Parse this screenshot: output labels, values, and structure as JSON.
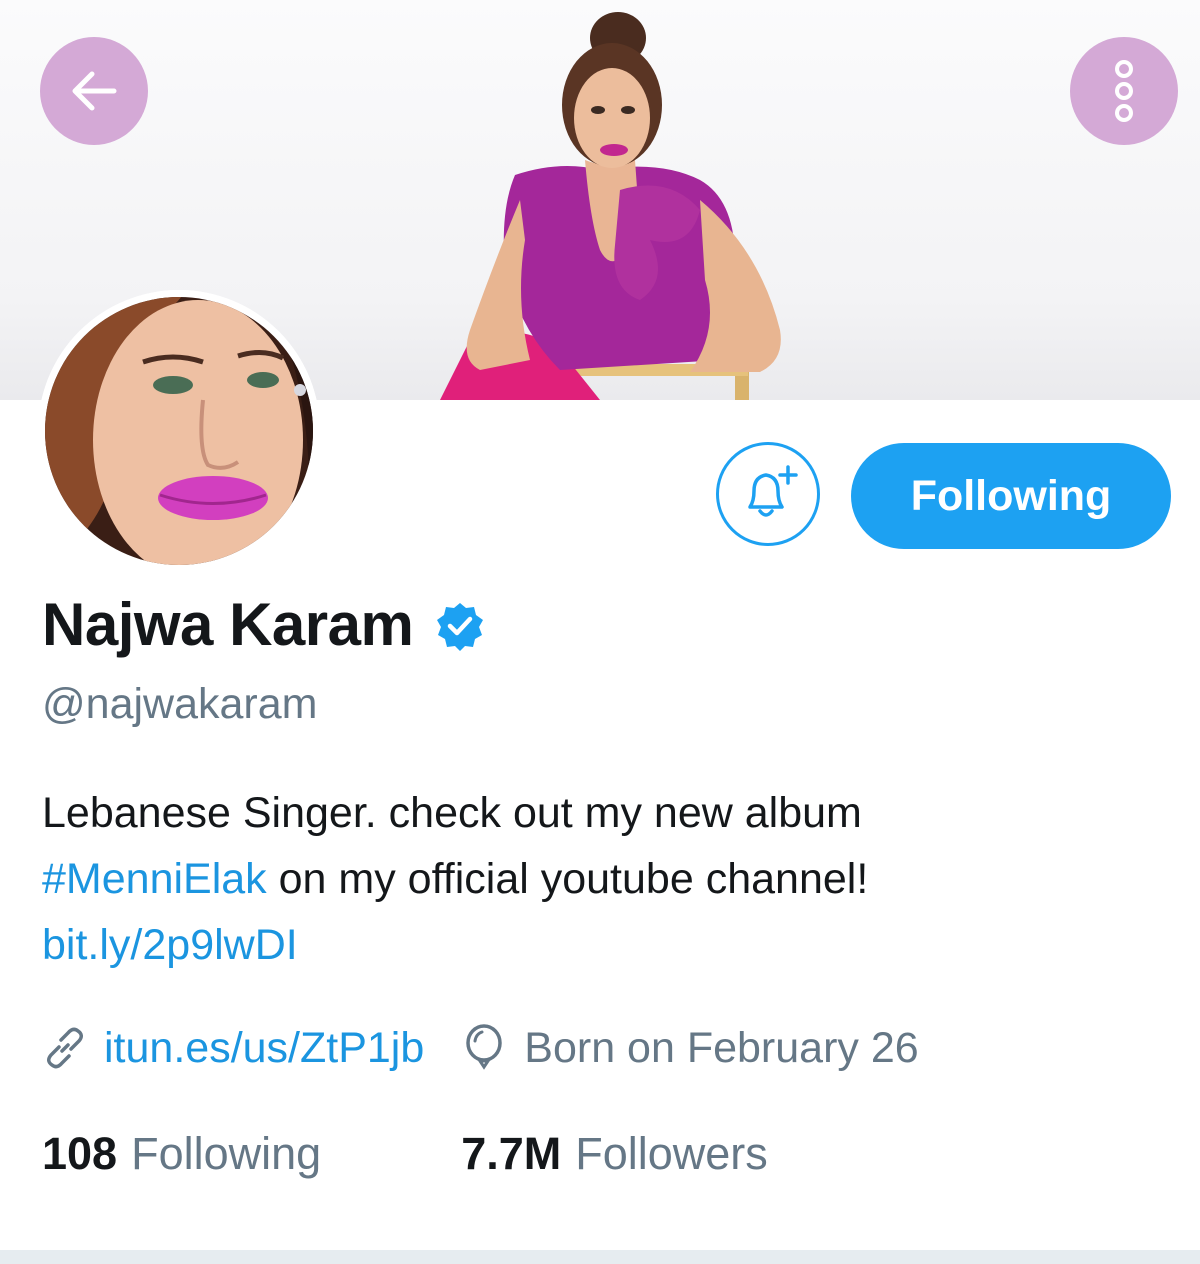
{
  "profile": {
    "name": "Najwa Karam",
    "handle": "@najwakaram",
    "verified": true,
    "bio_line1": "Lebanese Singer. check out my new album",
    "bio_hashtag": "#MenniElak",
    "bio_line2_rest": " on my official youtube channel!",
    "bio_link": "bit.ly/2p9lwDI",
    "website": "itun.es/us/ZtP1jb",
    "birthday": "Born on February 26"
  },
  "stats": {
    "following_count": "108",
    "following_label": "Following",
    "followers_count": "7.7M",
    "followers_label": "Followers"
  },
  "actions": {
    "follow_label": "Following",
    "back_icon": "arrow-left-icon",
    "more_icon": "more-vertical-icon",
    "notify_icon": "bell-plus-icon"
  },
  "colors": {
    "accent": "#1da1f2",
    "link": "#1b95e0",
    "secondary_text": "#657786",
    "overlay_button": "#d4a9d6"
  }
}
